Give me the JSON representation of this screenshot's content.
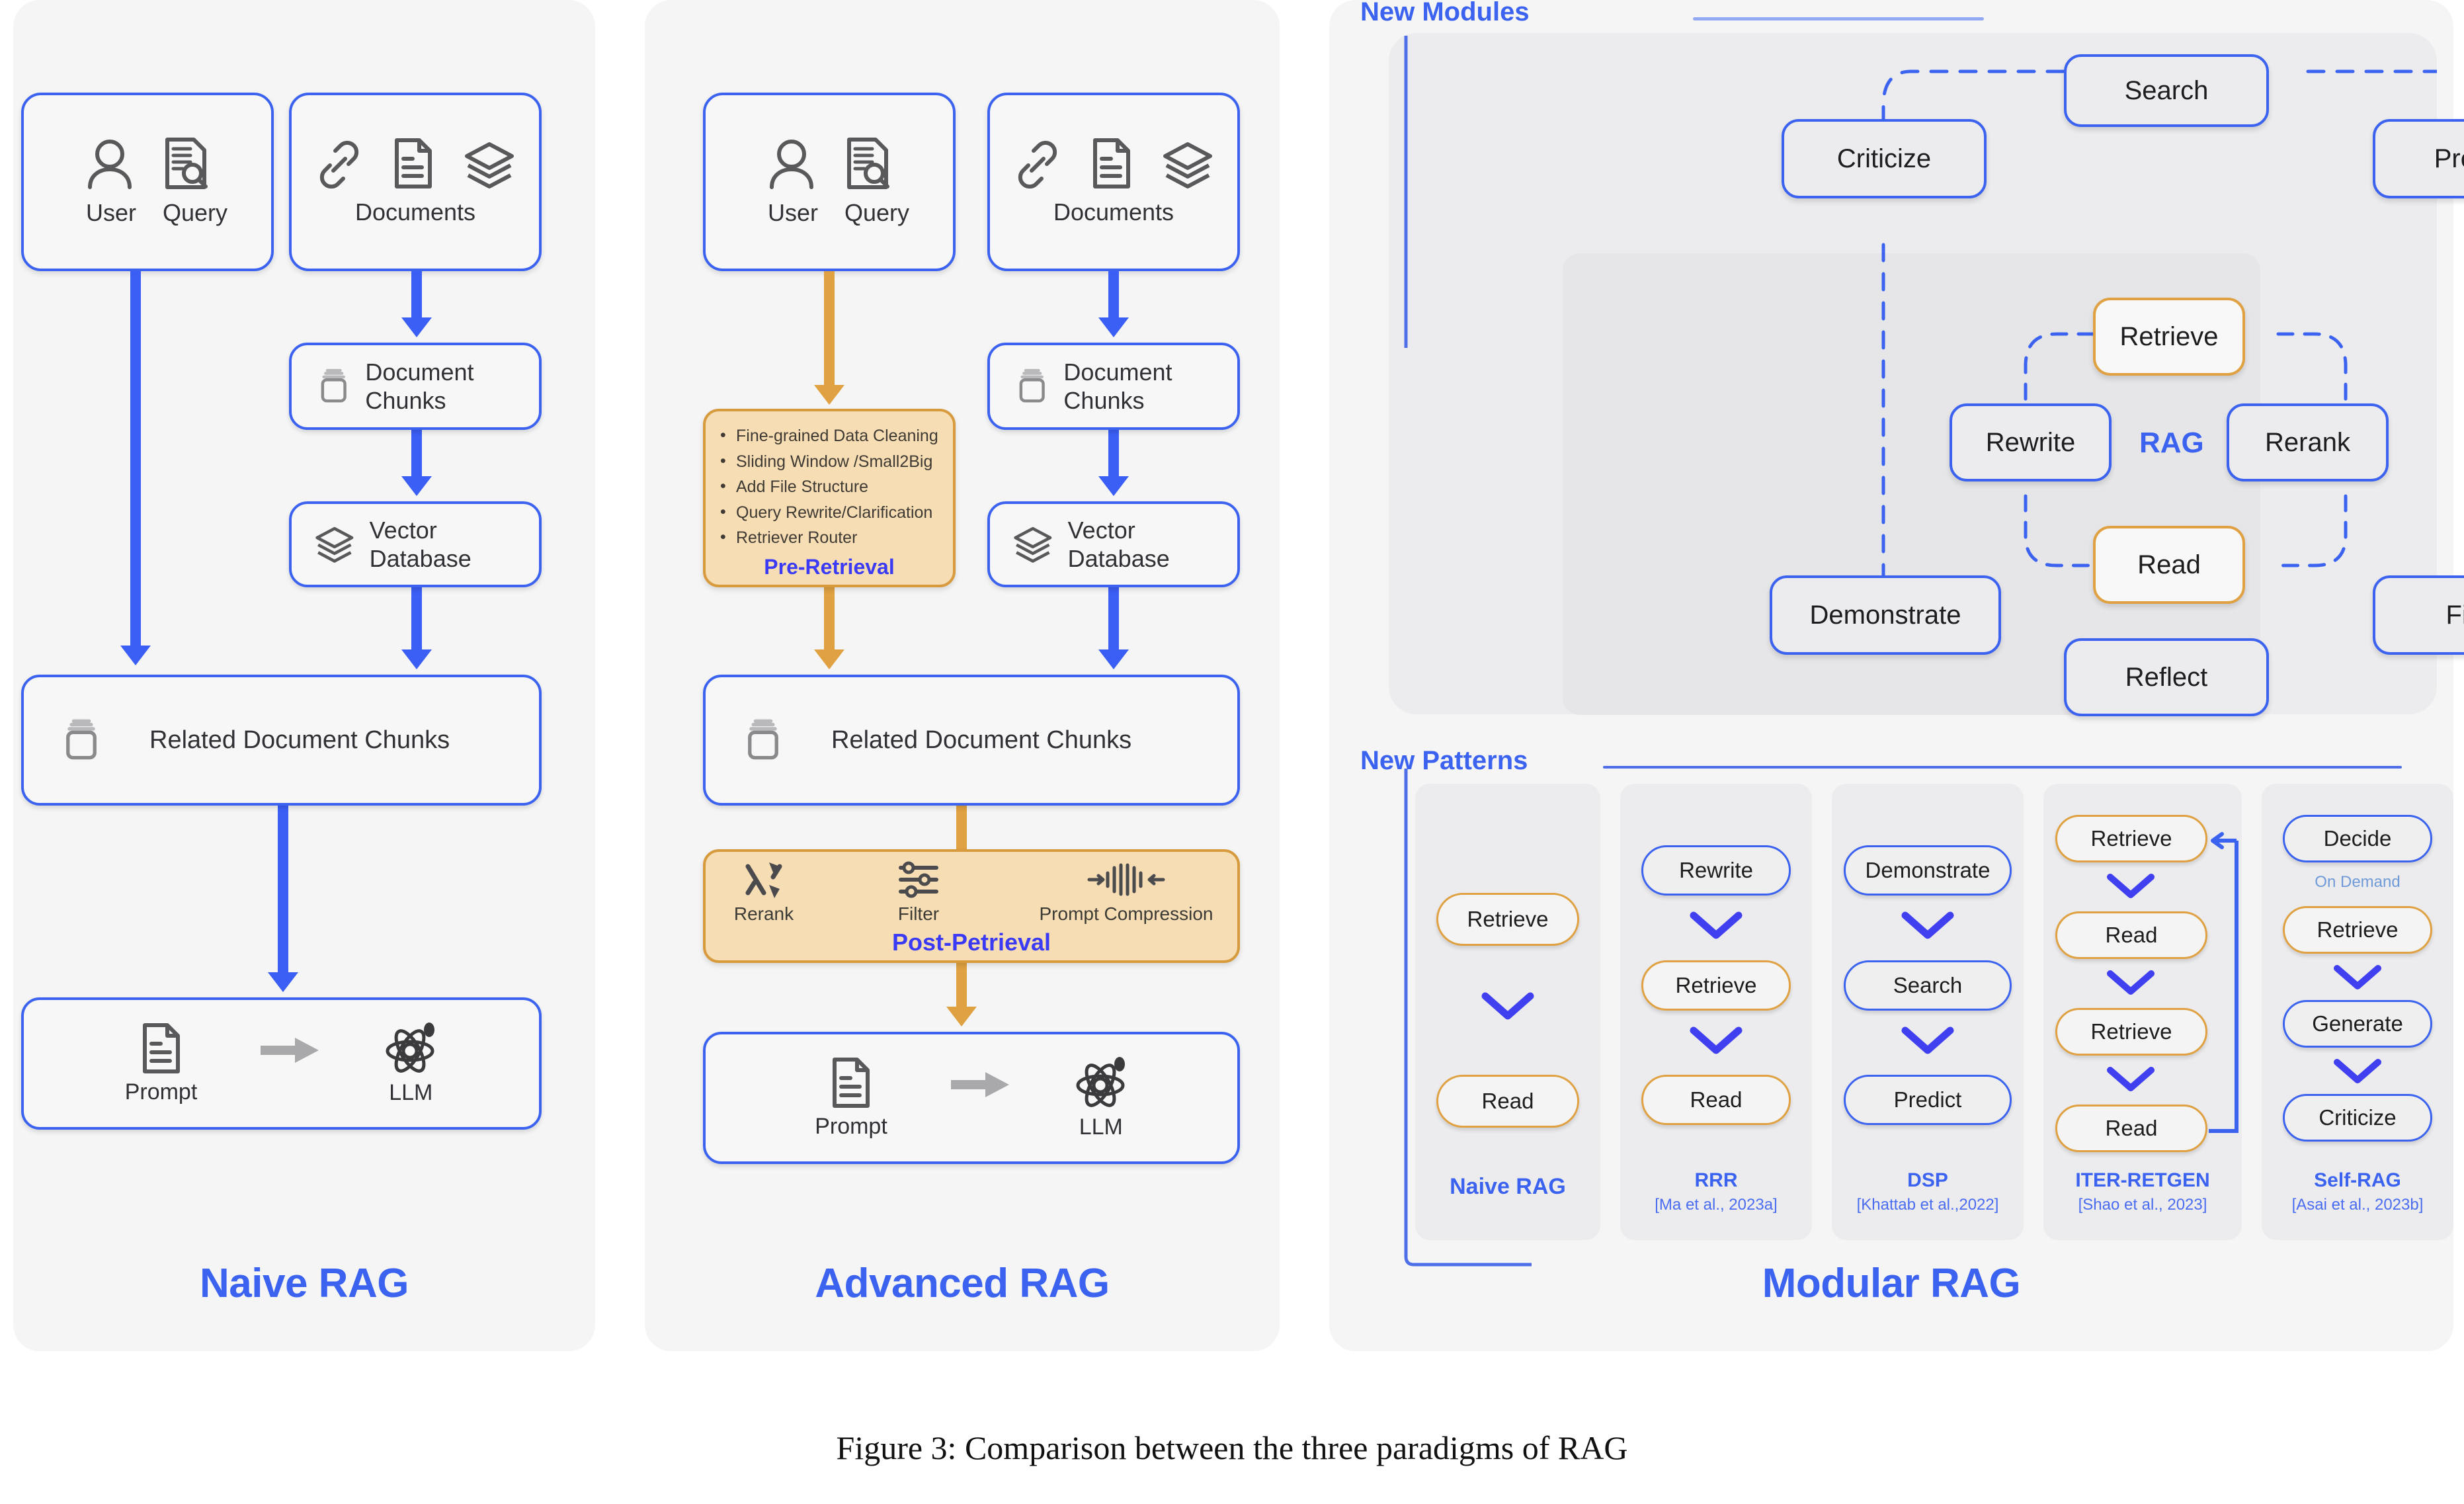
{
  "figure": {
    "caption": "Figure 3: Comparison between the three paradigms of RAG"
  },
  "colors": {
    "blue": "#3b63f0",
    "arrow_blue": "#3b5ef5",
    "orange_border": "#d79b3d",
    "orange_fill": "#f6ddb4",
    "arrow_orange": "#dfa141",
    "panel_grey": "#f5f5f6",
    "module_grey": "#ececee",
    "on_demand": "#6f9ad8"
  },
  "naive": {
    "title": "Naive RAG",
    "user_query": {
      "icons": [
        "user-icon",
        "query-document-search-icon"
      ],
      "labels": [
        "User",
        "Query"
      ]
    },
    "documents": {
      "icons": [
        "link-icon",
        "document-icon",
        "layers-icon"
      ],
      "label": "Documents"
    },
    "document_chunks": {
      "icon": "chunks-jar-icon",
      "label": "Document\nChunks"
    },
    "vector_database": {
      "icon": "layers-icon",
      "label": "Vector\nDatabase"
    },
    "related_chunks": {
      "icon": "chunks-jar-icon",
      "label": "Related Document Chunks"
    },
    "prompt_llm": {
      "prompt_label": "Prompt",
      "llm_label": "LLM",
      "prompt_icon": "document-icon",
      "arrow_icon": "right-arrow-icon",
      "llm_icon": "atom-icon"
    }
  },
  "advanced": {
    "title": "Advanced RAG",
    "user_query": {
      "icons": [
        "user-icon",
        "query-document-search-icon"
      ],
      "labels": [
        "User",
        "Query"
      ]
    },
    "documents": {
      "icons": [
        "link-icon",
        "document-icon",
        "layers-icon"
      ],
      "label": "Documents"
    },
    "document_chunks": {
      "icon": "chunks-jar-icon",
      "label": "Document\nChunks"
    },
    "vector_database": {
      "icon": "layers-icon",
      "label": "Vector\nDatabase"
    },
    "related_chunks": {
      "icon": "chunks-jar-icon",
      "label": "Related Document Chunks"
    },
    "pre_retrieval": {
      "tag": "Pre-Retrieval",
      "items": [
        "Fine-grained Data Cleaning",
        "Sliding Window /Small2Big",
        "Add File Structure",
        "Query Rewrite/Clarification",
        "Retriever Router"
      ]
    },
    "post_retrieval": {
      "tag": "Post-Petrieval",
      "items": [
        {
          "icon": "shuffle-icon",
          "label": "Rerank"
        },
        {
          "icon": "sliders-icon",
          "label": "Filter"
        },
        {
          "icon": "compress-icon",
          "label": "Prompt Compression"
        }
      ]
    },
    "prompt_llm": {
      "prompt_label": "Prompt",
      "llm_label": "LLM",
      "prompt_icon": "document-icon",
      "arrow_icon": "right-arrow-icon",
      "llm_icon": "atom-icon"
    }
  },
  "modular": {
    "title": "Modular RAG",
    "new_modules": {
      "label": "New Modules",
      "center": "RAG",
      "inner_ring": [
        "Retrieve",
        "Rewrite",
        "Rerank",
        "Read"
      ],
      "outer_ring": [
        "Search",
        "Criticize",
        "Predict",
        "Demonstrate",
        "Filter",
        "Reflect"
      ],
      "nodes": {
        "search": "Search",
        "criticize": "Criticize",
        "predict": "Predict",
        "retrieve": "Retrieve",
        "rewrite": "Rewrite",
        "rerank": "Rerank",
        "read": "Read",
        "demonstrate": "Demonstrate",
        "filter": "Filter",
        "reflect": "Reflect"
      }
    },
    "new_patterns": {
      "label": "New Patterns",
      "columns": [
        {
          "name": "Naive RAG",
          "cite": "",
          "steps": [
            {
              "label": "Retrieve",
              "style": "orange"
            },
            {
              "label": "Read",
              "style": "orange"
            }
          ],
          "spaced": true
        },
        {
          "name": "RRR",
          "cite": "[Ma et al., 2023a]",
          "steps": [
            {
              "label": "Rewrite",
              "style": "blue"
            },
            {
              "label": "Retrieve",
              "style": "orange"
            },
            {
              "label": "Read",
              "style": "orange"
            }
          ]
        },
        {
          "name": "DSP",
          "cite": "[Khattab et al.,2022]",
          "steps": [
            {
              "label": "Demonstrate",
              "style": "blue"
            },
            {
              "label": "Search",
              "style": "blue"
            },
            {
              "label": "Predict",
              "style": "blue"
            }
          ]
        },
        {
          "name": "ITER-RETGEN",
          "cite": "[Shao et al., 2023]",
          "steps": [
            {
              "label": "Retrieve",
              "style": "orange"
            },
            {
              "label": "Read",
              "style": "orange"
            },
            {
              "label": "Retrieve",
              "style": "orange"
            },
            {
              "label": "Read",
              "style": "orange"
            }
          ],
          "loop": true
        },
        {
          "name": "Self-RAG",
          "cite": "[Asai et al., 2023b]",
          "note": "On Demand",
          "steps": [
            {
              "label": "Decide",
              "style": "blue"
            },
            {
              "label": "Retrieve",
              "style": "orange"
            },
            {
              "label": "Generate",
              "style": "blue"
            },
            {
              "label": "Criticize",
              "style": "blue"
            }
          ]
        }
      ]
    }
  }
}
